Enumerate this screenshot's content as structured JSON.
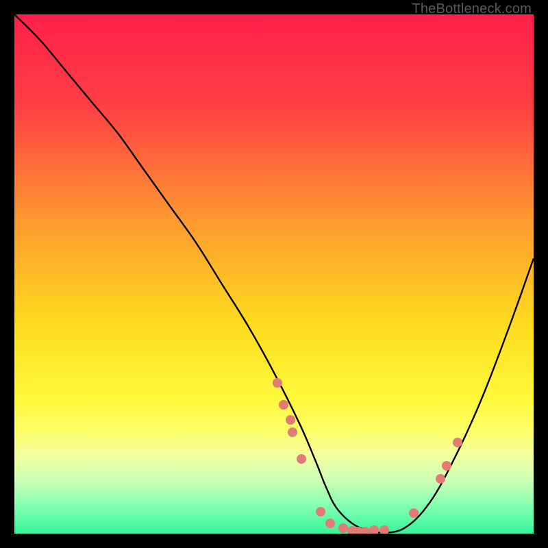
{
  "watermark": "TheBottleneck.com",
  "colors": {
    "dot_fill": "#e27a76",
    "curve_stroke": "#000000",
    "background": "#000000",
    "gradient_stops": [
      {
        "pct": 0,
        "color": "#ff1f4a"
      },
      {
        "pct": 18,
        "color": "#ff4044"
      },
      {
        "pct": 40,
        "color": "#ff9a2f"
      },
      {
        "pct": 60,
        "color": "#ffdc1e"
      },
      {
        "pct": 74,
        "color": "#fff83a"
      },
      {
        "pct": 80,
        "color": "#feff66"
      },
      {
        "pct": 85,
        "color": "#f3ffa0"
      },
      {
        "pct": 90,
        "color": "#c9ffb4"
      },
      {
        "pct": 95,
        "color": "#7dffb1"
      },
      {
        "pct": 100,
        "color": "#36f39c"
      }
    ]
  },
  "chart_data": {
    "type": "line",
    "title": "",
    "xlabel": "",
    "ylabel": "",
    "xlim": [
      0,
      100
    ],
    "ylim": [
      0,
      100
    ],
    "series": [
      {
        "name": "bottleneck-curve",
        "x": [
          0,
          5,
          10,
          15,
          20,
          25,
          30,
          35,
          40,
          45,
          50,
          55,
          58,
          60,
          62,
          65,
          68,
          70,
          75,
          80,
          85,
          90,
          95,
          100
        ],
        "y": [
          100,
          95,
          89,
          83,
          77,
          70,
          63,
          56,
          48,
          40,
          31,
          21,
          14,
          9,
          5,
          2,
          0.6,
          0.2,
          1,
          6,
          15,
          26,
          39,
          53
        ]
      }
    ],
    "markers": [
      {
        "x": 50.7,
        "y": 29.0
      },
      {
        "x": 51.8,
        "y": 24.8
      },
      {
        "x": 53.2,
        "y": 21.9
      },
      {
        "x": 53.6,
        "y": 19.5
      },
      {
        "x": 55.3,
        "y": 14.4
      },
      {
        "x": 59.0,
        "y": 4.2
      },
      {
        "x": 60.8,
        "y": 2.0
      },
      {
        "x": 63.3,
        "y": 1.1
      },
      {
        "x": 65.0,
        "y": 0.5
      },
      {
        "x": 66.2,
        "y": 0.4
      },
      {
        "x": 67.6,
        "y": 0.4
      },
      {
        "x": 69.2,
        "y": 0.6
      },
      {
        "x": 69.3,
        "y": 0.6
      },
      {
        "x": 71.2,
        "y": 0.7
      },
      {
        "x": 76.9,
        "y": 4.0
      },
      {
        "x": 82.1,
        "y": 10.6
      },
      {
        "x": 83.2,
        "y": 13.1
      },
      {
        "x": 85.3,
        "y": 17.5
      }
    ]
  }
}
